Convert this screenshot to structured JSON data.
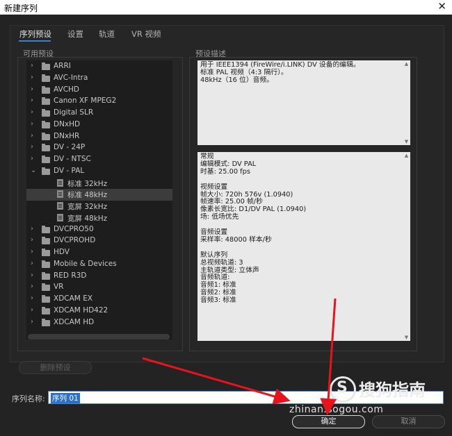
{
  "window": {
    "title": "新建序列",
    "close_glyph": "✕"
  },
  "tabs": [
    {
      "label": "序列预设",
      "active": true
    },
    {
      "label": "设置",
      "active": false
    },
    {
      "label": "轨道",
      "active": false
    },
    {
      "label": "VR 视频",
      "active": false
    }
  ],
  "available_presets": {
    "label": "可用预设",
    "items": [
      {
        "label": "ARRI",
        "type": "folder",
        "expanded": false
      },
      {
        "label": "AVC-Intra",
        "type": "folder",
        "expanded": false
      },
      {
        "label": "AVCHD",
        "type": "folder",
        "expanded": false
      },
      {
        "label": "Canon XF MPEG2",
        "type": "folder",
        "expanded": false
      },
      {
        "label": "Digital SLR",
        "type": "folder",
        "expanded": false
      },
      {
        "label": "DNxHD",
        "type": "folder",
        "expanded": false
      },
      {
        "label": "DNxHR",
        "type": "folder",
        "expanded": false
      },
      {
        "label": "DV - 24P",
        "type": "folder",
        "expanded": false
      },
      {
        "label": "DV - NTSC",
        "type": "folder",
        "expanded": false
      },
      {
        "label": "DV - PAL",
        "type": "folder",
        "expanded": true
      },
      {
        "label": "标准 32kHz",
        "type": "preset",
        "selected": false
      },
      {
        "label": "标准 48kHz",
        "type": "preset",
        "selected": true
      },
      {
        "label": "宽屏 32kHz",
        "type": "preset",
        "selected": false
      },
      {
        "label": "宽屏 48kHz",
        "type": "preset",
        "selected": false
      },
      {
        "label": "DVCPRO50",
        "type": "folder",
        "expanded": false
      },
      {
        "label": "DVCPROHD",
        "type": "folder",
        "expanded": false
      },
      {
        "label": "HDV",
        "type": "folder",
        "expanded": false
      },
      {
        "label": "Mobile & Devices",
        "type": "folder",
        "expanded": false
      },
      {
        "label": "RED R3D",
        "type": "folder",
        "expanded": false
      },
      {
        "label": "VR",
        "type": "folder",
        "expanded": false
      },
      {
        "label": "XDCAM EX",
        "type": "folder",
        "expanded": false
      },
      {
        "label": "XDCAM HD422",
        "type": "folder",
        "expanded": false
      },
      {
        "label": "XDCAM HD",
        "type": "folder",
        "expanded": false
      }
    ]
  },
  "preset_description": {
    "label": "预设描述",
    "summary_lines": [
      "用于 IEEE1394 (FireWire/i.LINK) DV 设备的编辑。",
      "标准 PAL 视频（4:3 隔行）。",
      "48kHz（16 位）音频。"
    ],
    "details_lines": [
      "常规",
      " 编辑模式: DV PAL",
      " 时基: 25.00 fps",
      "",
      "视频设置",
      " 帧大小: 720h 576v (1.0940)",
      " 帧速率: 25.00 帧/秒",
      " 像素长宽比: D1/DV PAL (1.0940)",
      " 场: 低场优先",
      "",
      "音频设置",
      " 采样率: 48000 样本/秒",
      "",
      "默认序列",
      " 总视频轨道: 3",
      " 主轨道类型: 立体声",
      " 音频轨道:",
      " 音频1: 标准",
      " 音频2: 标准",
      " 音频3: 标准"
    ]
  },
  "delete_preset_label": "删除预设",
  "sequence_name": {
    "label": "序列名称:",
    "value": "序列 01"
  },
  "buttons": {
    "ok": "确定",
    "cancel": "取消"
  },
  "watermark": {
    "brand": "搜狗指南",
    "url": "zhinan.sogou.com"
  },
  "annotation_color": "#e8141c"
}
